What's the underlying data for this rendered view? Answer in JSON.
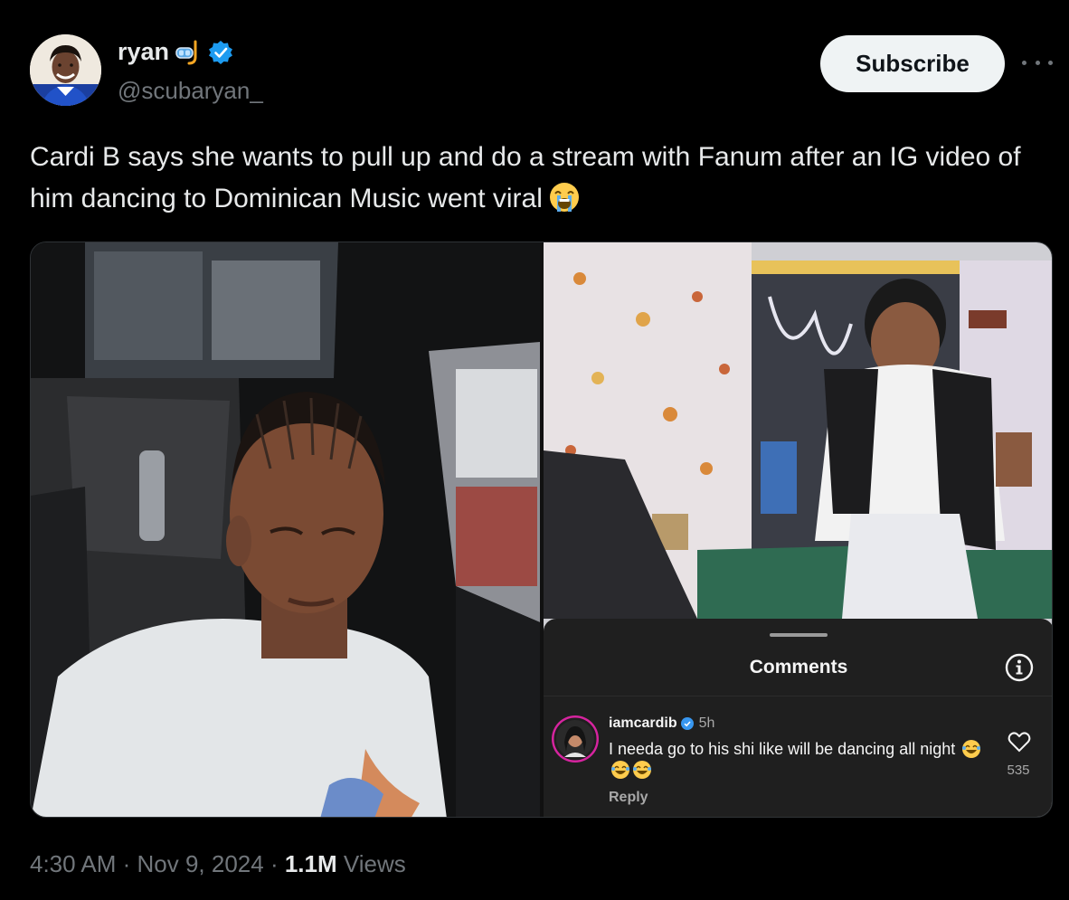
{
  "author": {
    "display_name": "ryan",
    "handle": "@scubaryan_",
    "name_icons": [
      "snorkel-icon",
      "verified-icon"
    ],
    "verified_color": "#1d9bf0"
  },
  "actions": {
    "subscribe_label": "Subscribe",
    "more_icon": "more-dots-icon"
  },
  "tweet": {
    "text": "Cardi B says she wants to pull up and do a stream with Fanum after an IG video of him dancing to Dominican Music went viral",
    "trailing_emoji": "loudly-crying-face"
  },
  "embedded_comment": {
    "sheet_title": "Comments",
    "username": "iamcardib",
    "time": "5h",
    "text": "I needa go to his shi  like will be dancing all night",
    "trailing_emojis": [
      "laughing-crying-face",
      "laughing-crying-face",
      "laughing-crying-face"
    ],
    "reply_label": "Reply",
    "like_count": "535"
  },
  "footer": {
    "time": "4:30 AM",
    "sep1": " · ",
    "date": "Nov 9, 2024",
    "sep2": " · ",
    "views_count": "1.1M",
    "views_label": " Views"
  },
  "colors": {
    "background": "#000000",
    "text_primary": "#e7e9ea",
    "text_secondary": "#71767b",
    "button_bg": "#eff3f4",
    "ig_sheet_bg": "#1f1f1f"
  }
}
